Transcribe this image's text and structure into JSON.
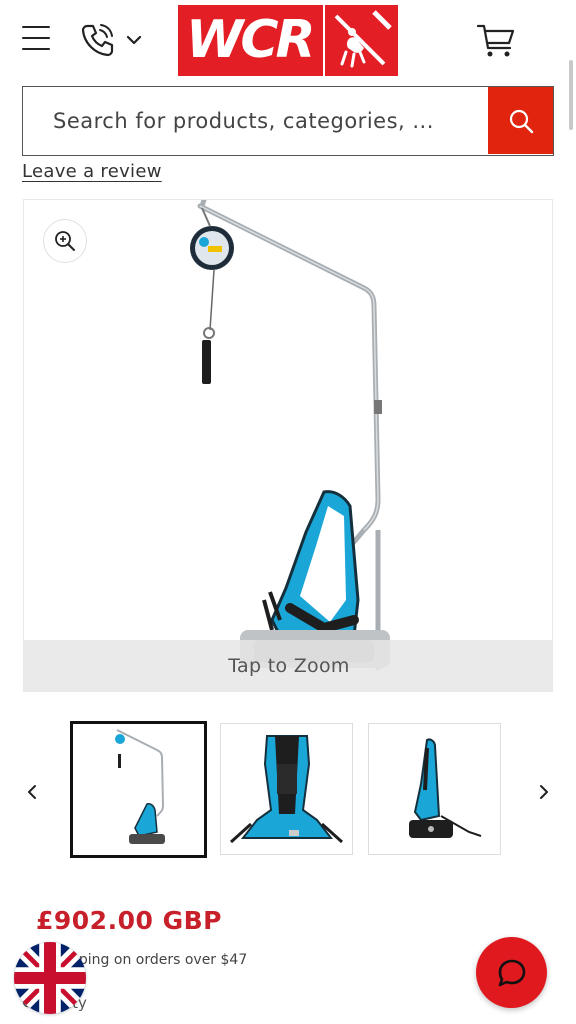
{
  "header": {
    "menu_icon": "hamburger-icon",
    "phone_icon": "phone-icon",
    "logo_text": "WCR",
    "cart_icon": "cart-icon"
  },
  "search": {
    "placeholder": "Search for products, categories, ...",
    "button_icon": "search-icon"
  },
  "review": {
    "link_label": "Leave a review"
  },
  "gallery": {
    "zoom_icon": "zoom-in-icon",
    "tap_to_zoom": "Tap to Zoom",
    "prev_icon": "chevron-left-icon",
    "next_icon": "chevron-right-icon",
    "thumbnail_count": 3,
    "active_thumbnail": 1
  },
  "product": {
    "price": "£902.00 GBP",
    "shipping_text": "pping on orders over $47",
    "quantity_label": "ity"
  },
  "floating": {
    "flag_icon": "uk-flag-icon",
    "chat_icon": "chat-bubble-icon"
  },
  "colors": {
    "brand_red": "#e31e24",
    "search_button": "#e0240e",
    "price_red": "#c8202a",
    "harness_blue": "#1aa6d6"
  }
}
